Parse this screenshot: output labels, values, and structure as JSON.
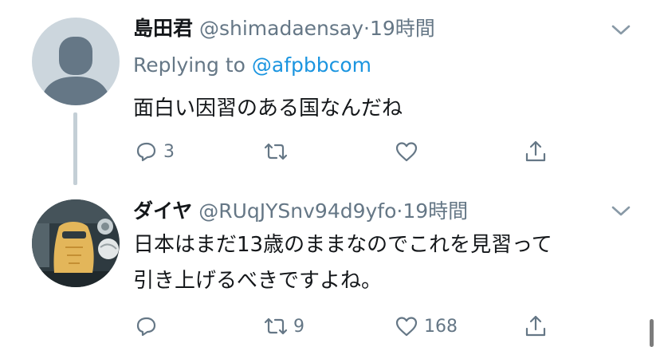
{
  "tweets": [
    {
      "display_name": "島田君",
      "handle": "@shimadaensay",
      "separator": "·",
      "time": "19時間",
      "reply_prefix": "Replying to",
      "reply_to": "@afpbbcom",
      "text": "面白い因習のある国なんだね",
      "reply_count": "3",
      "retweet_count": "",
      "like_count": ""
    },
    {
      "display_name": "ダイヤ",
      "handle": "@RUqJYSnv94d9yfo",
      "separator": "·",
      "time": "19時間",
      "text_line1": "日本はまだ13歳のままなのでこれを見習って",
      "text_line2": "引き上げるべきですよね。",
      "reply_count": "",
      "retweet_count": "9",
      "like_count": "168"
    }
  ],
  "icons": {
    "reply": "reply-icon",
    "retweet": "retweet-icon",
    "like": "heart-icon",
    "share": "share-icon",
    "more": "chevron-down-icon"
  },
  "colors": {
    "text": "#14171a",
    "secondary": "#657786",
    "link": "#1b95e0",
    "thread_line": "#c4cfd6",
    "default_avatar_bg": "#ccd6dd",
    "default_avatar_fg": "#657786"
  }
}
